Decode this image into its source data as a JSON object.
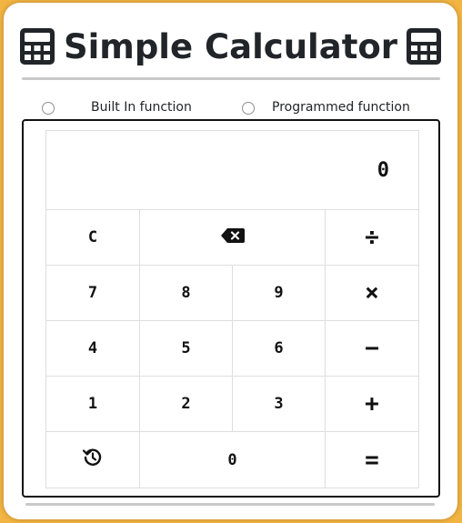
{
  "title": "Simple Calculator",
  "icons": {
    "title_left": "calculator-icon",
    "title_right": "calculator-icon",
    "backspace": "backspace-icon",
    "history": "history-icon"
  },
  "mode_options": [
    {
      "label": "Built In function",
      "checked": false
    },
    {
      "label": "Programmed function",
      "checked": false
    }
  ],
  "display": {
    "value": "0"
  },
  "keys": {
    "clear": "C",
    "divide": "÷",
    "seven": "7",
    "eight": "8",
    "nine": "9",
    "multiply": "×",
    "four": "4",
    "five": "5",
    "six": "6",
    "minus": "−",
    "one": "1",
    "two": "2",
    "three": "3",
    "plus": "+",
    "zero": "0",
    "equals": "="
  },
  "colors": {
    "background": "#f2b442",
    "card": "#ffffff",
    "text": "#212529"
  }
}
